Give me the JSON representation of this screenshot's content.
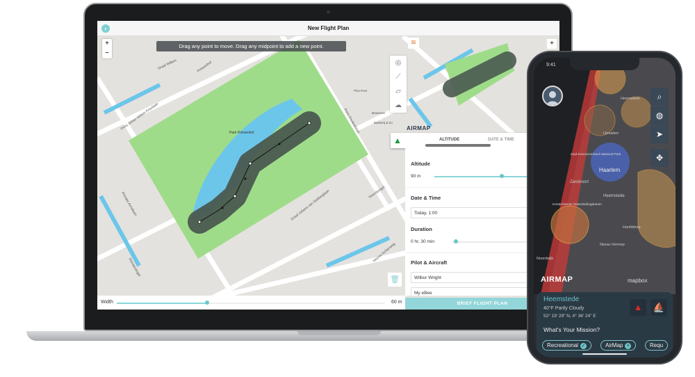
{
  "laptop": {
    "title": "New Flight Plan",
    "back_icon": "chevron-left-icon",
    "tooltip": "Drag any point to move. Drag any midpoint to add a new point.",
    "zoom_in": "+",
    "zoom_out": "−",
    "map_labels": [
      "Park Prinsenhof",
      "Prinsenhof",
      "Prins Johan Willem Frisolaan",
      "Graaf Willem",
      "Prinses Annalaan",
      "Graaf Juliana van Stolberglaan",
      "Noordsingel",
      "Prins Frederiklaan",
      "Plus Post",
      "Brasserie",
      "Bakkerij & Zo",
      "Prinsessingel",
      "Veurse Achterweg"
    ],
    "brand": "AIRMAP",
    "tabs": [
      {
        "label": "ALTITUDE",
        "active": true
      },
      {
        "label": "DATE & TIME",
        "active": false
      }
    ],
    "panel": {
      "altitude_label": "Altitude",
      "altitude_value": "90 m",
      "datetime_label": "Date & Time",
      "datetime_value": "Today, 1:00",
      "duration_label": "Duration",
      "duration_value": "0 hr, 30 min",
      "pilot_label": "Pilot & Aircraft",
      "pilot_value": "Wilbur Wright",
      "aircraft_value": "My eBee"
    },
    "width_label": "Width",
    "width_value": "60 m",
    "brief_button": "BRIEF FLIGHT PLAN",
    "colors": {
      "accent": "#93d6d9",
      "park": "#9fdc8a",
      "water": "#6cc6ea",
      "path": "#4a5a50"
    }
  },
  "phone": {
    "time": "9:41",
    "map_labels": [
      "Heemskerk",
      "IJmuiden",
      "Zuid-Kennemerland National Park",
      "Haarlem",
      "Zandvoort",
      "Heemstede",
      "Amsterdamse Waterleidingduinen",
      "Hoofddorp",
      "Nieuw-Vennep",
      "Noordwijk"
    ],
    "tools": [
      "search-icon",
      "globe-icon",
      "navigation-arrow-icon",
      "satellite-icon"
    ],
    "brand": "AIRMAP",
    "mapbox": "mapbox",
    "location": "Heemstede",
    "weather": "40°F Partly Cloudy",
    "coords": "52° 19' 29\" N, 4° 36' 24\" E",
    "mission_label": "What's Your Mission?",
    "chips": [
      "Recreational",
      "AirMap",
      "Requ"
    ]
  }
}
